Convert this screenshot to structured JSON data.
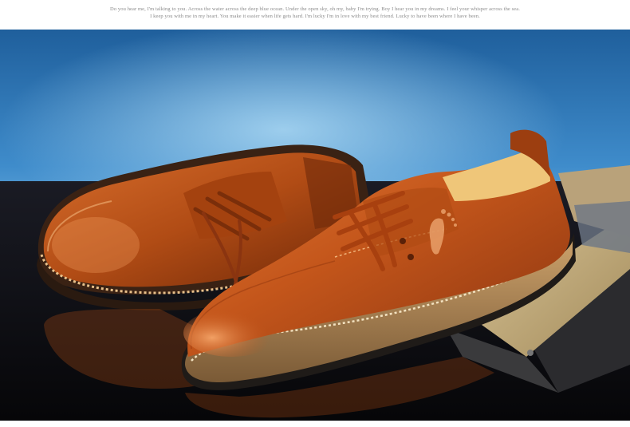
{
  "banner": {
    "line1": "Do you hear me, I'm talking to you. Across the water across the deep blue ocean. Under the open sky, oh my, baby I'm trying. Boy I hear you in my dreams. I feel your whisper across the sea.",
    "line2": "I keep you with me in my heart. You make it easier when life gets hard. I'm lucky I'm in love with my best friend. Lucky to have been where I have been."
  },
  "photo": {
    "subject": "brown-leather-oxford-shoes",
    "colors": {
      "sky_top": "#1e6aa8",
      "sky_mid": "#4f9fd6",
      "sky_light": "#86c2ea",
      "leather": "#c2561a",
      "leather_dark": "#7d2e0a",
      "leather_light": "#e78a4a",
      "lining": "#f0c878",
      "sole": "#2a2622",
      "welt": "#e9b980",
      "floor": "#0d0c10",
      "box": "#c9b383"
    }
  }
}
